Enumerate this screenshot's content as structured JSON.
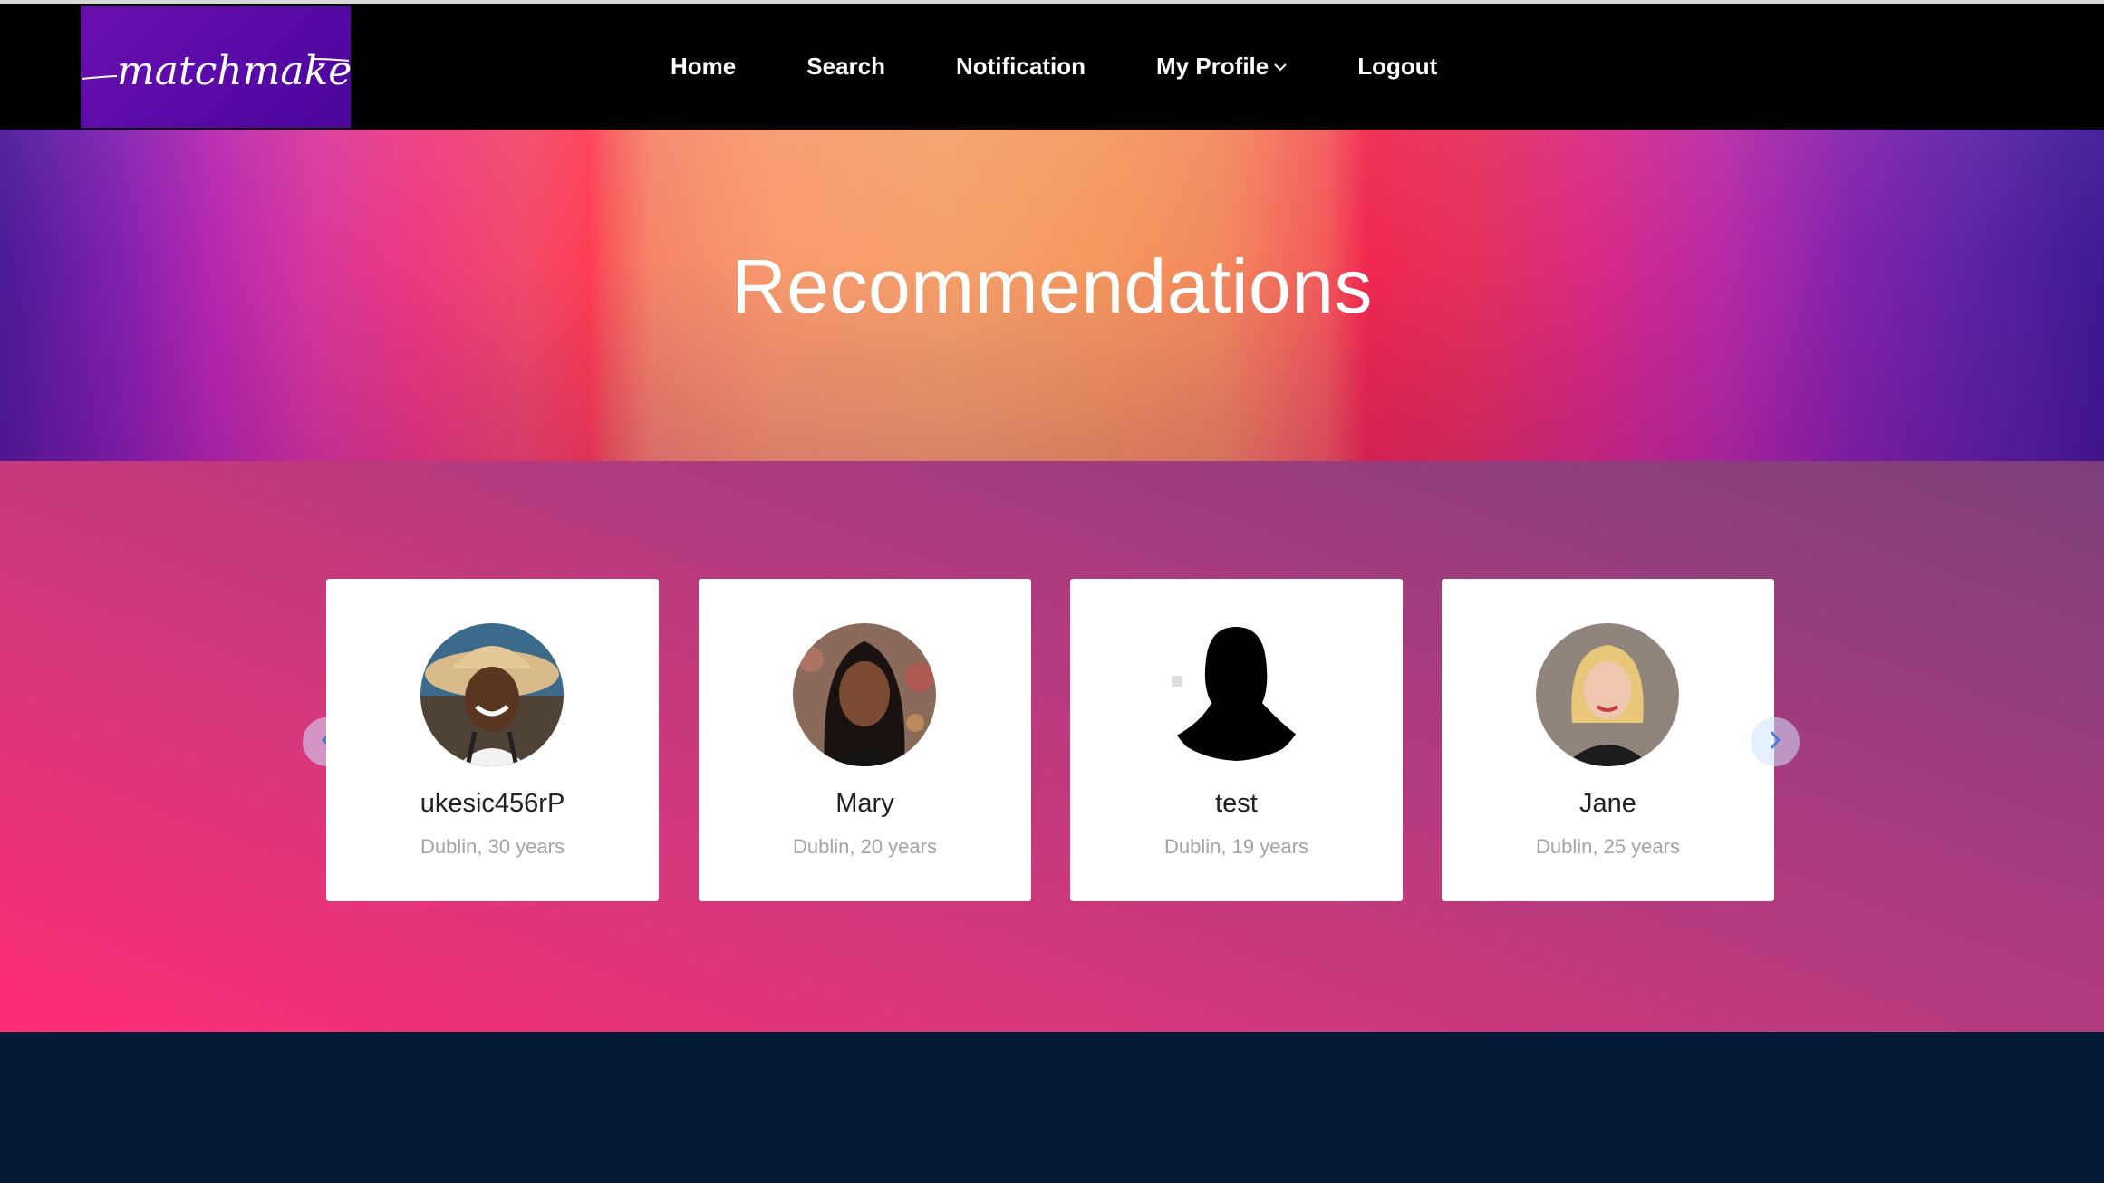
{
  "brand": {
    "logo_text": "matchmaker"
  },
  "nav": {
    "items": [
      {
        "label": "Home"
      },
      {
        "label": "Search"
      },
      {
        "label": "Notification"
      },
      {
        "label": "My Profile"
      },
      {
        "label": "Logout"
      }
    ]
  },
  "hero": {
    "title": "Recommendations"
  },
  "recommendations": [
    {
      "name": "ukesic456rP",
      "meta": "Dublin, 30 years",
      "avatar": "woman-with-hat"
    },
    {
      "name": "Mary",
      "meta": "Dublin, 20 years",
      "avatar": "woman-portrait"
    },
    {
      "name": "test",
      "meta": "Dublin, 19 years",
      "avatar": "silhouette"
    },
    {
      "name": "Jane",
      "meta": "Dublin, 25 years",
      "avatar": "blonde-woman"
    }
  ],
  "colors": {
    "navbar": "#000000",
    "logo_bg": "#5a0aa8",
    "footer": "#021a35",
    "arrow_icon": "#3a7bd5"
  }
}
